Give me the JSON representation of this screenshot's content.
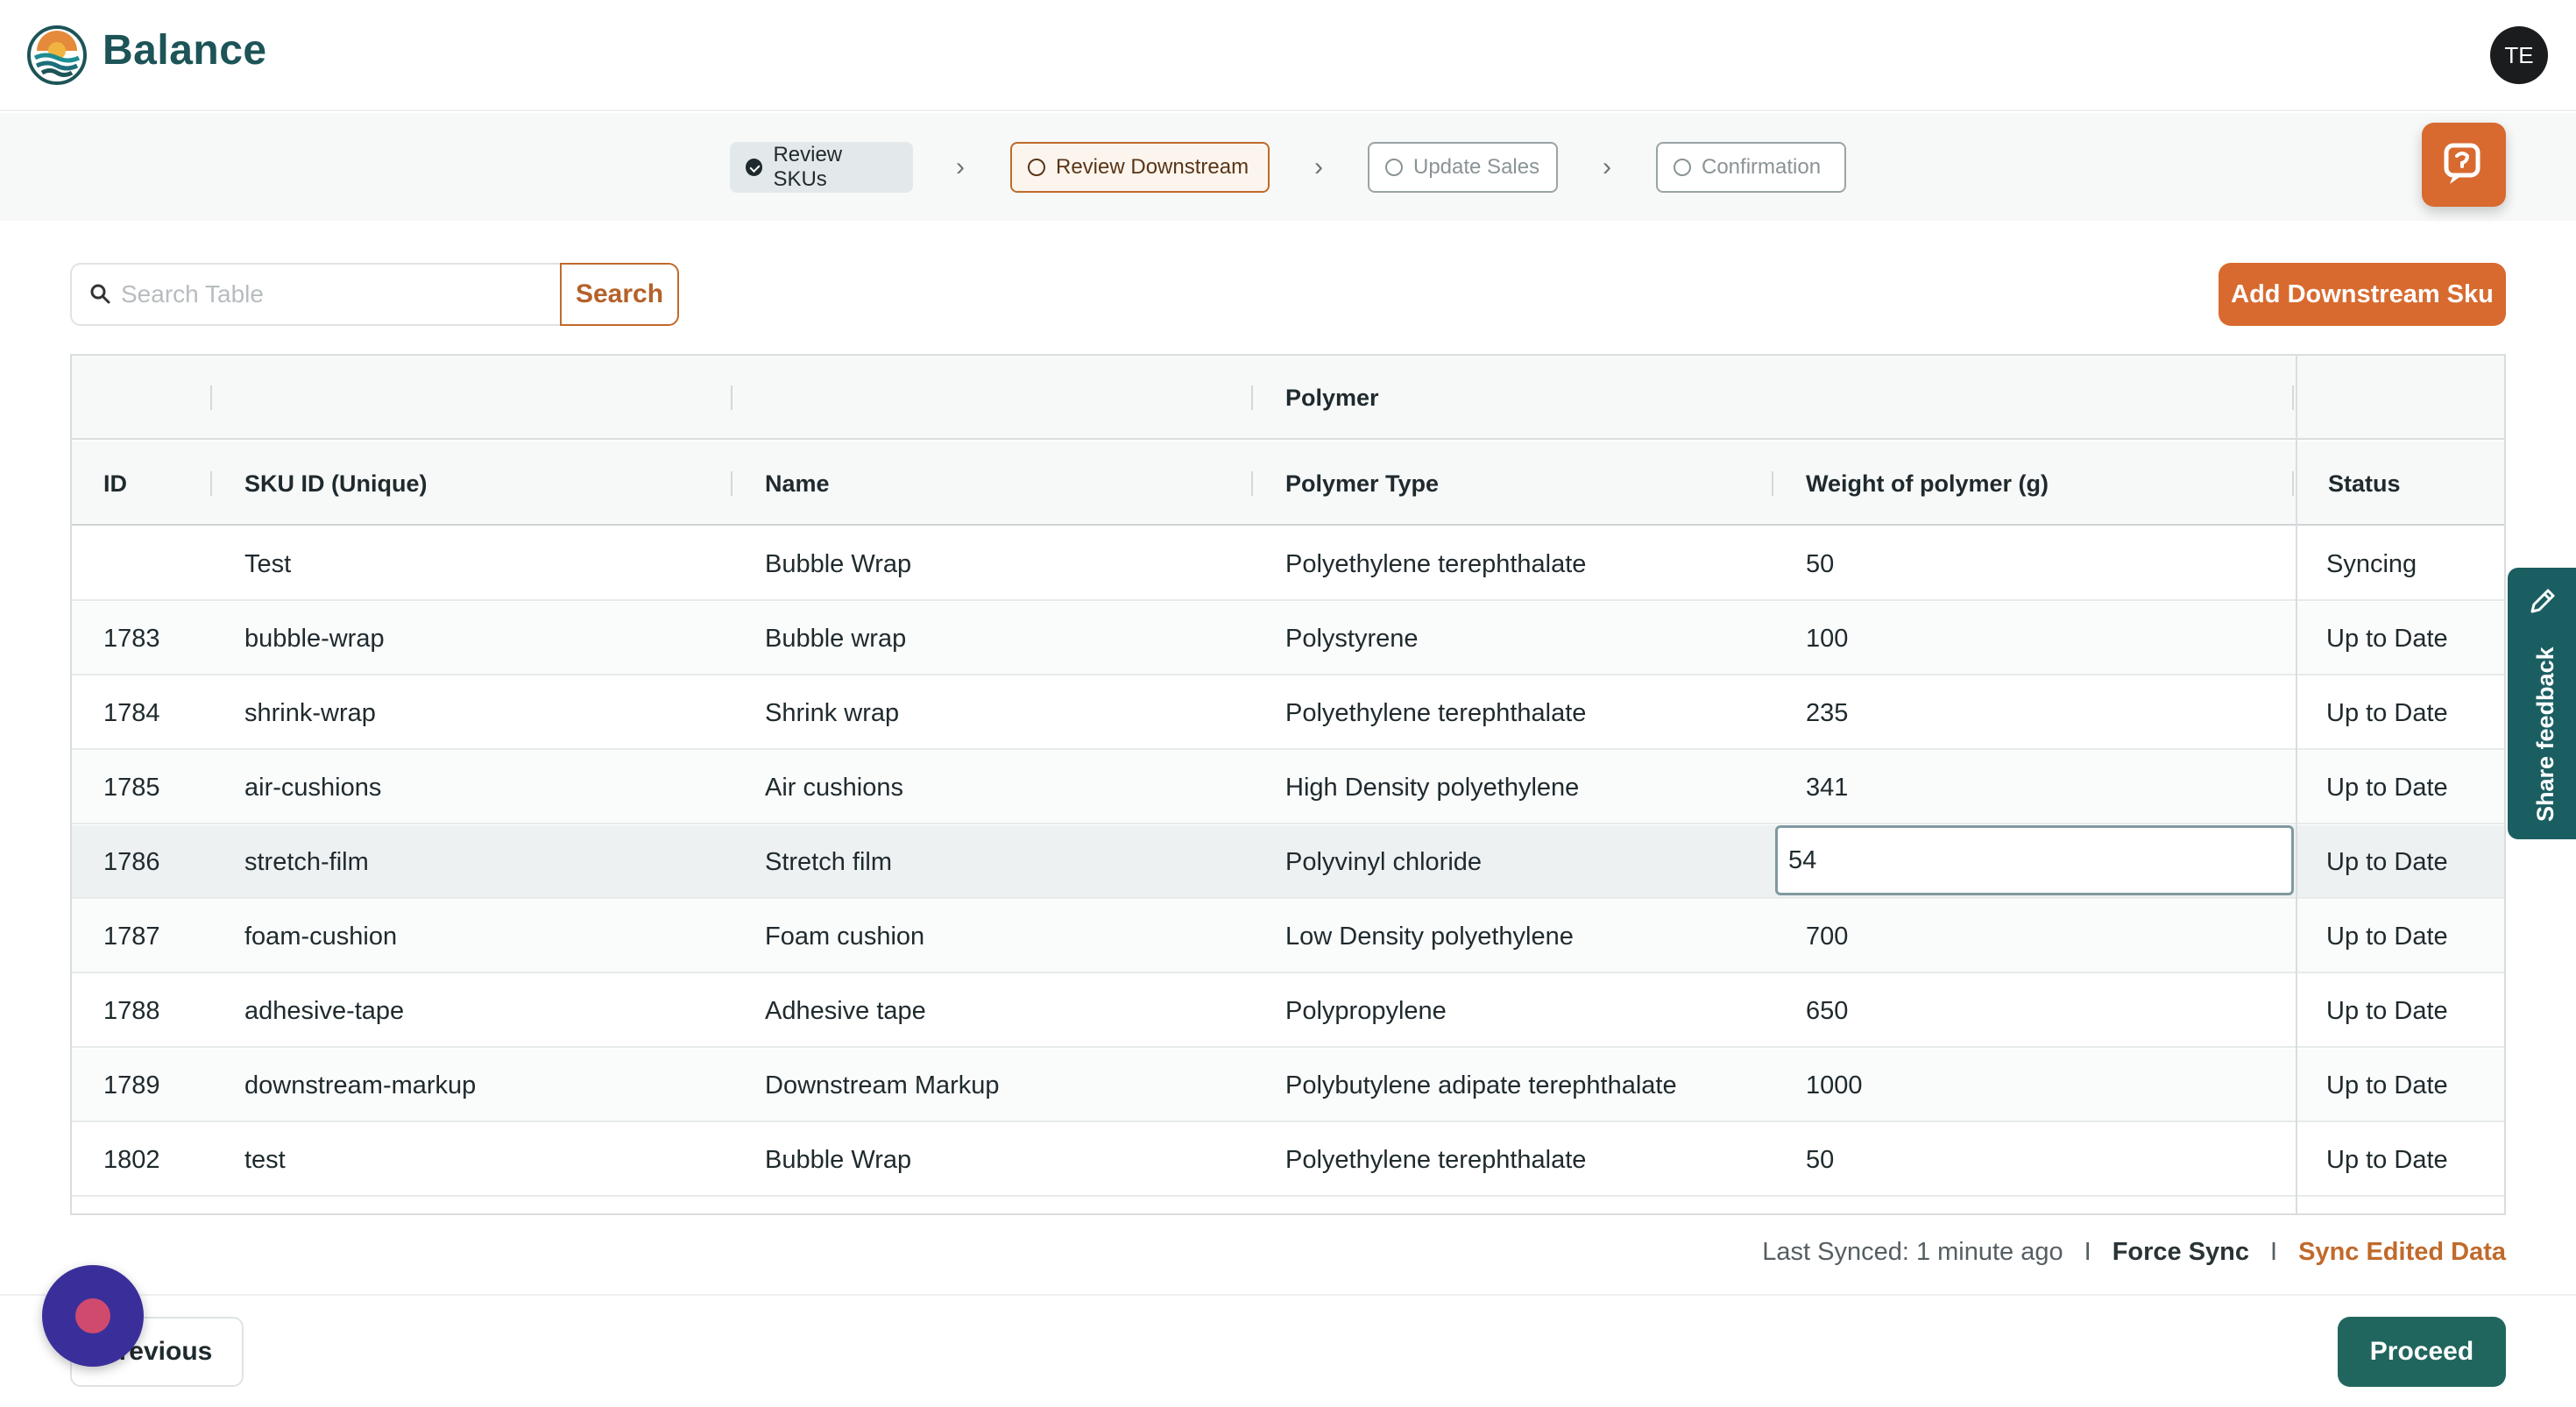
{
  "app": {
    "brand": "Balance",
    "avatar_initials": "TE"
  },
  "stepper": {
    "steps": [
      {
        "label": "Review SKUs",
        "state": "completed"
      },
      {
        "label": "Review Downstream",
        "state": "active"
      },
      {
        "label": "Update Sales",
        "state": "pending"
      },
      {
        "label": "Confirmation",
        "state": "pending"
      }
    ]
  },
  "toolbar": {
    "search_placeholder": "Search Table",
    "search_value": "",
    "search_label": "Search",
    "add_label": "Add Downstream Sku"
  },
  "table": {
    "group_header": "Polymer",
    "columns": [
      "ID",
      "SKU ID (Unique)",
      "Name",
      "Polymer Type",
      "Weight of polymer (g)",
      "Status"
    ],
    "rows": [
      {
        "id": "",
        "sku": "Test",
        "name": "Bubble Wrap",
        "type": "Polyethylene terephthalate",
        "weight": "50",
        "status": "Syncing"
      },
      {
        "id": "1783",
        "sku": "bubble-wrap",
        "name": "Bubble wrap",
        "type": "Polystyrene",
        "weight": "100",
        "status": "Up to Date"
      },
      {
        "id": "1784",
        "sku": "shrink-wrap",
        "name": "Shrink wrap",
        "type": "Polyethylene terephthalate",
        "weight": "235",
        "status": "Up to Date"
      },
      {
        "id": "1785",
        "sku": "air-cushions",
        "name": "Air cushions",
        "type": "High Density polyethylene",
        "weight": "341",
        "status": "Up to Date"
      },
      {
        "id": "1786",
        "sku": "stretch-film",
        "name": "Stretch film",
        "type": "Polyvinyl chloride",
        "weight": "54",
        "status": "Up to Date"
      },
      {
        "id": "1787",
        "sku": "foam-cushion",
        "name": "Foam cushion",
        "type": "Low Density polyethylene",
        "weight": "700",
        "status": "Up to Date"
      },
      {
        "id": "1788",
        "sku": "adhesive-tape",
        "name": "Adhesive tape",
        "type": "Polypropylene",
        "weight": "650",
        "status": "Up to Date"
      },
      {
        "id": "1789",
        "sku": "downstream-markup",
        "name": "Downstream Markup",
        "type": "Polybutylene adipate terephthalate",
        "weight": "1000",
        "status": "Up to Date"
      },
      {
        "id": "1802",
        "sku": "test",
        "name": "Bubble Wrap",
        "type": "Polyethylene terephthalate",
        "weight": "50",
        "status": "Up to Date"
      }
    ],
    "editing_row_index": 4
  },
  "sync": {
    "last_synced": "Last Synced: 1 minute ago",
    "separator": "I",
    "force_label": "Force Sync",
    "edited_label": "Sync Edited Data"
  },
  "footer": {
    "previous_label": "Previous",
    "proceed_label": "Proceed"
  },
  "feedback": {
    "label": "Share feedback"
  },
  "colors": {
    "brand": "#1d5457",
    "accent": "#d86a2f",
    "proceed": "#20665e",
    "feedback_tab": "#1b5e62"
  },
  "icons": [
    "logo-icon",
    "check-circle-icon",
    "circle-icon",
    "chevron-right-icon",
    "help-chat-icon",
    "search-icon",
    "edit-pencil-icon",
    "chat-bubble-icon"
  ]
}
